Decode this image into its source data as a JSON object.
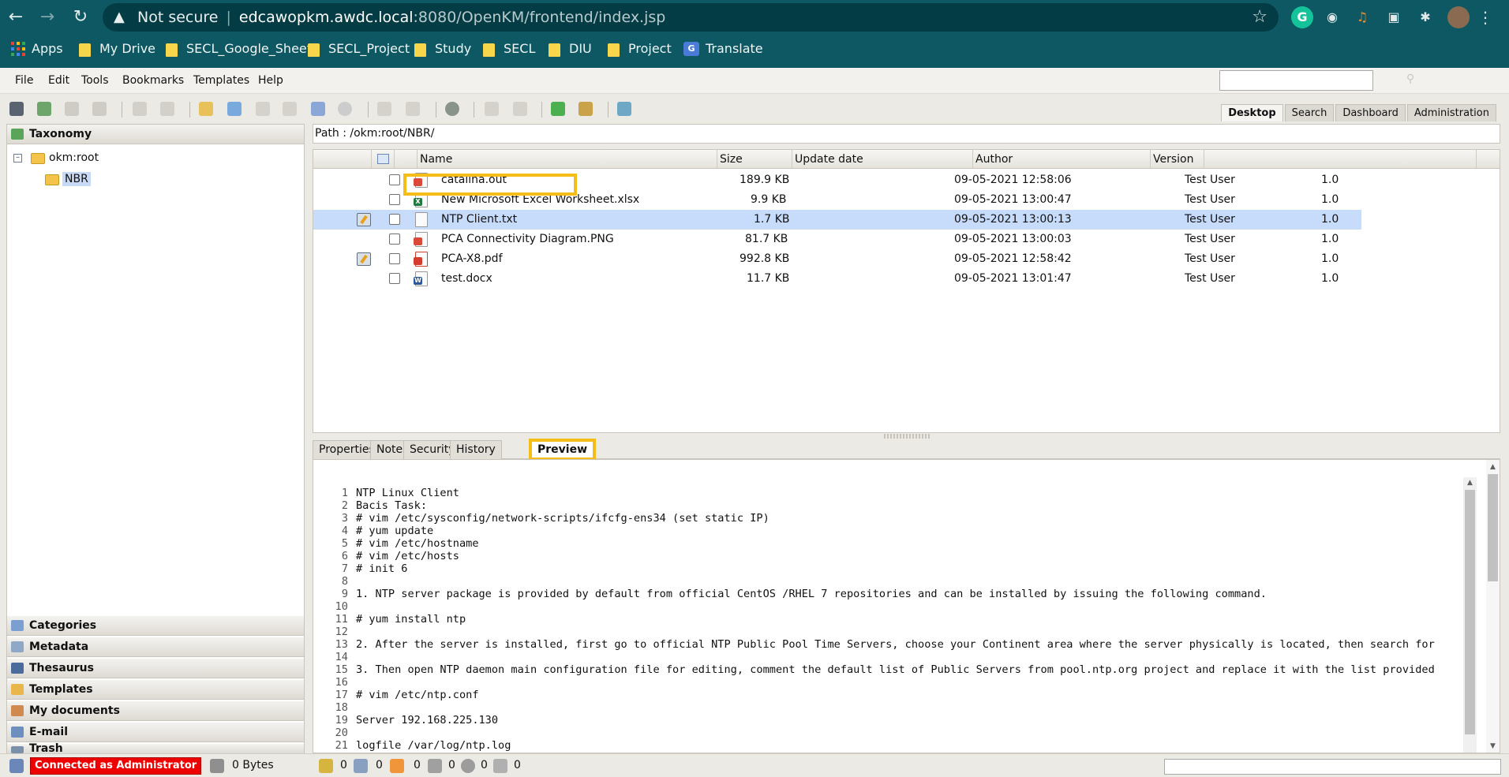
{
  "browser": {
    "security_label": "Not secure",
    "url_host": "edcawopkm.awdc.local",
    "url_rest": ":8080/OpenKM/frontend/index.jsp",
    "bookmarks": {
      "apps": "Apps",
      "b1": "My Drive",
      "b2": "SECL_Google_Sheet",
      "b3": "SECL_Project",
      "b4": "Study",
      "b5": "SECL",
      "b6": "DIU",
      "b7": "Project",
      "b8": "Translate"
    }
  },
  "menu": {
    "file": "File",
    "edit": "Edit",
    "tools": "Tools",
    "bookmarks": "Bookmarks",
    "templates": "Templates",
    "help": "Help"
  },
  "workspace_tabs": {
    "desktop": "Desktop",
    "search": "Search",
    "dashboard": "Dashboard",
    "administration": "Administration"
  },
  "left_panel": {
    "taxonomy": "Taxonomy",
    "root": "okm:root",
    "folder": "NBR",
    "stacks": {
      "categories": "Categories",
      "metadata": "Metadata",
      "thesaurus": "Thesaurus",
      "templates": "Templates",
      "my_documents": "My documents",
      "email": "E-mail",
      "trash": "Trash"
    }
  },
  "path": "Path : /okm:root/NBR/",
  "file_table": {
    "columns": {
      "name": "Name",
      "size": "Size",
      "updated": "Update date",
      "author": "Author",
      "version": "Version"
    },
    "rows": {
      "r0": {
        "name": "catalina.out",
        "size": "189.9 KB",
        "updated": "09-05-2021 12:58:06",
        "author": "Test User",
        "version": "1.0"
      },
      "r1": {
        "name": "New Microsoft Excel Worksheet.xlsx",
        "size": "9.9 KB",
        "updated": "09-05-2021 13:00:47",
        "author": "Test User",
        "version": "1.0"
      },
      "r2": {
        "name": "NTP Client.txt",
        "size": "1.7 KB",
        "updated": "09-05-2021 13:00:13",
        "author": "Test User",
        "version": "1.0"
      },
      "r3": {
        "name": "PCA Connectivity Diagram.PNG",
        "size": "81.7 KB",
        "updated": "09-05-2021 13:00:03",
        "author": "Test User",
        "version": "1.0"
      },
      "r4": {
        "name": "PCA-X8.pdf",
        "size": "992.8 KB",
        "updated": "09-05-2021 12:58:42",
        "author": "Test User",
        "version": "1.0"
      },
      "r5": {
        "name": "test.docx",
        "size": "11.7 KB",
        "updated": "09-05-2021 13:01:47",
        "author": "Test User",
        "version": "1.0"
      }
    }
  },
  "detail_tabs": {
    "properties": "Properties",
    "notes": "Notes",
    "security": "Security",
    "history": "History",
    "preview": "Preview"
  },
  "preview_lines": {
    "l1": "NTP Linux Client",
    "l2": "Bacis Task:",
    "l3": "# vim /etc/sysconfig/network-scripts/ifcfg-ens34 (set static IP)",
    "l4": "# yum update",
    "l5": "# vim /etc/hostname",
    "l6": "# vim /etc/hosts",
    "l7": "# init 6",
    "l8": "",
    "l9": "1. NTP server package is provided by default from official CentOS /RHEL 7 repositories and can be installed by issuing the following command.",
    "l10": "",
    "l11": "# yum install ntp",
    "l12": "",
    "l13": "2. After the server is installed, first go to official NTP Public Pool Time Servers, choose your Continent area where the server physically is located, then search for",
    "l14": "",
    "l15": "3. Then open NTP daemon main configuration file for editing, comment the default list of Public Servers from pool.ntp.org project and replace it with the list provided",
    "l16": "",
    "l17": "# vim /etc/ntp.conf",
    "l18": "",
    "l19": "Server 192.168.225.130",
    "l20": "",
    "l21": "logfile /var/log/ntp.log",
    "l22": ""
  },
  "status": {
    "connected": "Connected as Administrator",
    "bytes": "0 Bytes",
    "c1": "0",
    "c2": "0",
    "c3": "0",
    "c4": "0",
    "c5": "0",
    "c6": "0"
  }
}
